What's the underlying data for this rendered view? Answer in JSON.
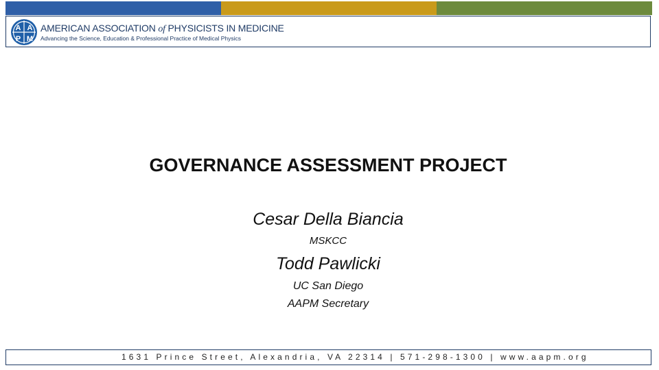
{
  "top_bar": {
    "colors": [
      "#2f5fa7",
      "#c99a1b",
      "#6d8a3d"
    ]
  },
  "header": {
    "logo_icon": "aapm-logo-icon",
    "org_name_part1": "AMERICAN ASSOCIATION ",
    "org_name_of": "of",
    "org_name_part2": " PHYSICISTS IN MEDICINE",
    "tagline": "Advancing the Science, Education & Professional Practice of Medical Physics",
    "brand_color": "#1f3b66",
    "logo_letters": "AAPM"
  },
  "slide": {
    "title": "GOVERNANCE ASSESSMENT PROJECT",
    "presenter1": {
      "name": "Cesar Della Biancia",
      "affiliation": "MSKCC"
    },
    "presenter2": {
      "name": "Todd Pawlicki",
      "affiliation": "UC San Diego",
      "role": "AAPM Secretary"
    }
  },
  "footer": {
    "address": "1631 Prince Street, Alexandria, VA 22314 | 571-298-1300 | www.aapm.org"
  }
}
